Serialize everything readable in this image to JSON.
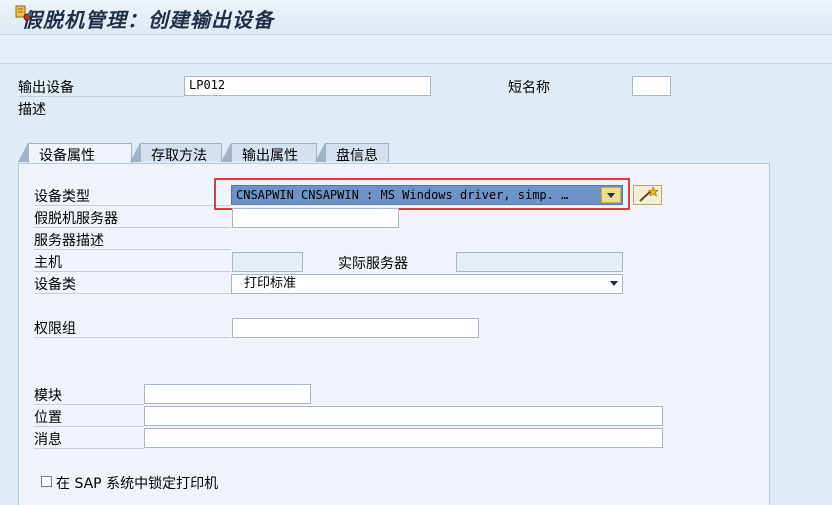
{
  "window": {
    "title": "假脱机管理：创建输出设备"
  },
  "header_fields": {
    "output_device_label": "输出设备",
    "output_device_value": "LP012",
    "short_name_label": "短名称",
    "short_name_value": "",
    "description_label": "描述"
  },
  "tabs": [
    {
      "label": "设备属性",
      "active": true
    },
    {
      "label": "存取方法",
      "active": false
    },
    {
      "label": "输出属性",
      "active": false
    },
    {
      "label": "盘信息",
      "active": false
    }
  ],
  "device_attributes": {
    "device_type_label": "设备类型",
    "device_type_value": "CNSAPWIN CNSAPWIN : MS Windows driver, simp. …",
    "spool_server_label": "假脱机服务器",
    "spool_server_value": "",
    "server_desc_label": "服务器描述",
    "host_label": "主机",
    "host_value": "",
    "actual_server_label": "实际服务器",
    "actual_server_value": "",
    "device_class_label": "设备类",
    "device_class_value": "打印标准",
    "auth_group_label": "权限组",
    "auth_group_value": "",
    "model_label": "模块",
    "model_value": "",
    "location_label": "位置",
    "location_value": "",
    "message_label": "消息",
    "message_value": "",
    "lock_printer_label": "在 SAP 系统中锁定打印机",
    "lock_printer_checked": false
  },
  "icons": {
    "toolbar_icon": "display-change-icon",
    "wizard_icon": "magic-wand-icon"
  },
  "colors": {
    "selection": "#6e93c7",
    "highlight_box": "#e23a3a",
    "dropdown_button": "#f5dc88"
  }
}
